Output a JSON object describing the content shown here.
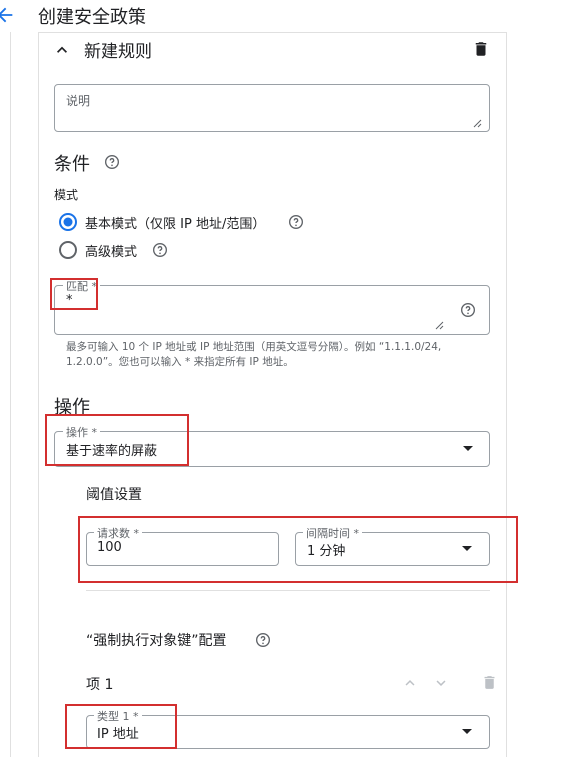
{
  "header": {
    "back_icon": "arrow-left-icon",
    "title": "创建安全政策"
  },
  "rule": {
    "collapse_icon": "chevron-up-icon",
    "title": "新建规则",
    "delete_icon": "trash-icon",
    "description_placeholder": "说明"
  },
  "conditions": {
    "heading": "条件",
    "help_icon": "help-circle-icon",
    "mode_label": "模式",
    "modes": [
      {
        "label": "基本模式（仅限 IP 地址/范围）",
        "selected": true
      },
      {
        "label": "高级模式",
        "selected": false
      }
    ],
    "match_label": "匹配 *",
    "match_value": "*",
    "helper_text": "最多可输入 10 个 IP 地址或 IP 地址范围（用英文逗号分隔）。例如 “1.1.1.0/24, 1.2.0.0”。您也可以输入 * 来指定所有 IP 地址。"
  },
  "action": {
    "heading": "操作",
    "label": "操作 *",
    "value": "基于速率的屏蔽"
  },
  "threshold": {
    "heading": "阈值设置",
    "request_count_label": "请求数 *",
    "request_count_value": "100",
    "interval_label": "间隔时间 *",
    "interval_value": "1 分钟"
  },
  "enforce_key": {
    "heading": "“强制执行对象键”配置",
    "item_title": "项 1",
    "type_label": "类型 1 *",
    "type_value": "IP 地址"
  },
  "colors": {
    "accent": "#1a73e8",
    "highlight": "#d32f2f",
    "text": "#202124",
    "muted": "#5f6368"
  }
}
